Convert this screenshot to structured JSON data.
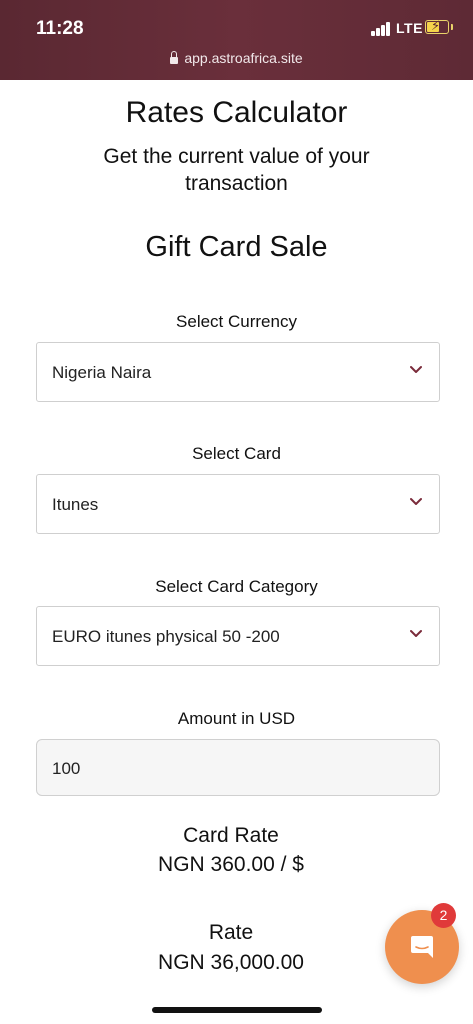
{
  "status_bar": {
    "time": "11:28",
    "network": "LTE"
  },
  "browser": {
    "url": "app.astroafrica.site"
  },
  "header": {
    "title": "Rates Calculator",
    "subtitle": "Get the current value of your transaction"
  },
  "section": {
    "title": "Gift Card Sale"
  },
  "form": {
    "currency": {
      "label": "Select Currency",
      "value": "Nigeria Naira"
    },
    "card": {
      "label": "Select Card",
      "value": "Itunes"
    },
    "category": {
      "label": "Select Card Category",
      "value": "EURO itunes physical 50 -200"
    },
    "amount": {
      "label": "Amount in USD",
      "value": "100"
    }
  },
  "results": {
    "card_rate_label": "Card Rate",
    "card_rate_value": "NGN 360.00 / $",
    "rate_label": "Rate",
    "rate_value": "NGN 36,000.00"
  },
  "chat": {
    "badge_count": "2",
    "button_color": "#ef8f4e",
    "badge_color": "#e03a3a"
  },
  "colors": {
    "status_bar": "#5a2832",
    "select_chevron": "#7a2b3a"
  }
}
